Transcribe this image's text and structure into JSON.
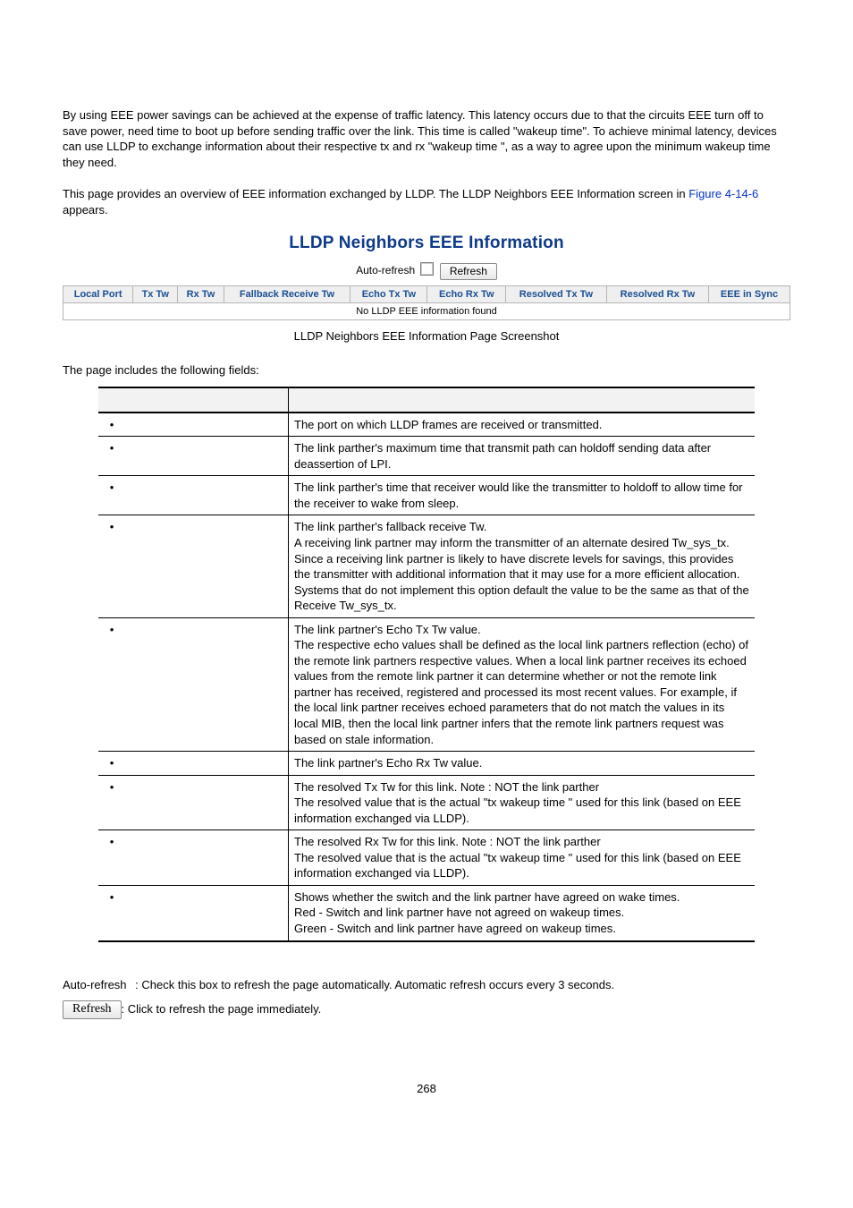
{
  "intro": {
    "para1": "By using EEE power savings can be achieved at the expense of traffic latency. This latency occurs due to that the circuits EEE turn off to save power, need time to boot up before sending traffic over the link. This time is called \"wakeup time\". To achieve minimal latency, devices can use LLDP to exchange information about their respective tx and rx \"wakeup time \", as a way to agree upon the minimum wakeup time they need.",
    "para2a": "This page provides an overview of EEE information exchanged by LLDP.   The LLDP Neighbors EEE Information screen in ",
    "figref": "Figure 4-14-6",
    "para2b": " appears."
  },
  "panel": {
    "title": "LLDP Neighbors EEE Information",
    "auto_label": "Auto-refresh",
    "refresh_label": "Refresh",
    "headers": [
      "Local Port",
      "Tx Tw",
      "Rx Tw",
      "Fallback Receive Tw",
      "Echo Tx Tw",
      "Echo Rx Tw",
      "Resolved Tx Tw",
      "Resolved Rx Tw",
      "EEE in Sync"
    ],
    "empty_row": "No LLDP EEE information found"
  },
  "caption": "LLDP Neighbors EEE Information Page Screenshot",
  "fields_intro": "The page includes the following fields:",
  "fields": [
    {
      "desc": "The port on which LLDP frames are received or transmitted."
    },
    {
      "desc": "The link parther's maximum time that transmit path can holdoff sending data after deassertion of LPI."
    },
    {
      "desc": "The link parther's time that receiver would like the transmitter to holdoff to allow time for the receiver to wake from sleep."
    },
    {
      "desc": "The link parther's fallback receive Tw.\nA receiving link partner may inform the transmitter of an alternate desired Tw_sys_tx. Since a receiving link partner is likely to have discrete levels for savings, this provides the transmitter with additional information that it may use for a more efficient allocation. Systems that do not implement this option default the value to be the same as that of the Receive Tw_sys_tx."
    },
    {
      "desc": "The link partner's Echo Tx Tw value.\nThe respective echo values shall be defined as the local link partners reflection (echo) of the remote link partners respective values. When a local link partner receives its echoed values from the remote link partner it can determine whether or not the remote link partner has received, registered and processed its most recent values. For example, if the local link partner receives echoed parameters that do not match the values in its local MIB, then the local link partner infers that the remote link partners request was based on stale information."
    },
    {
      "desc": "The link partner's Echo Rx Tw value."
    },
    {
      "desc": "The resolved Tx Tw for this link. Note : NOT the link parther\nThe resolved value that is the actual \"tx wakeup time \" used for this link (based on EEE information exchanged via LLDP)."
    },
    {
      "desc": "The resolved Rx Tw for this link. Note : NOT the link parther\nThe resolved value that is the actual \"tx wakeup time \" used for this link (based on EEE information exchanged via LLDP)."
    },
    {
      "desc": "Shows whether the switch and the link partner have agreed on wake times.\nRed - Switch and link partner have not agreed on wakeup times.\nGreen - Switch and link partner have agreed on wakeup times."
    }
  ],
  "post": {
    "auto_label": "Auto-refresh",
    "auto_desc": ": Check this box to refresh the page automatically. Automatic refresh occurs every 3 seconds.",
    "refresh_btn": "Refresh",
    "refresh_desc": ": Click to refresh the page immediately."
  },
  "pagenum": "268"
}
